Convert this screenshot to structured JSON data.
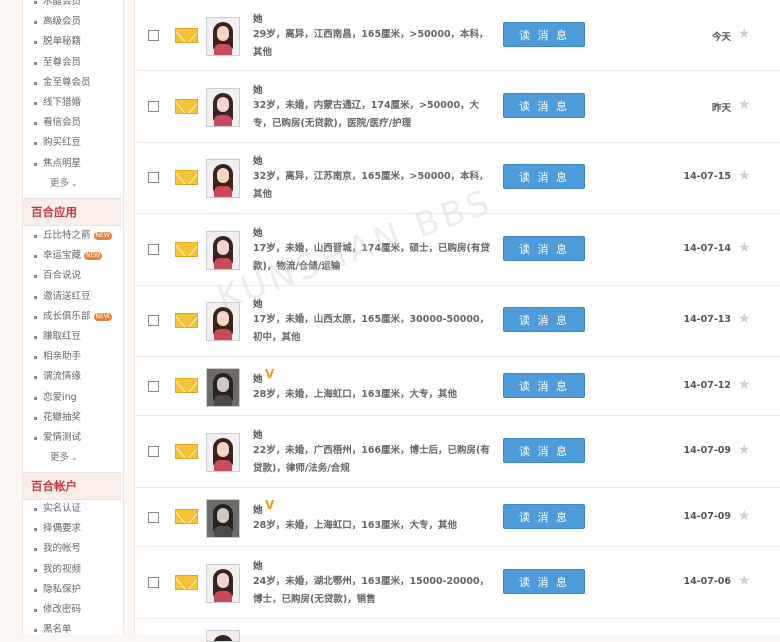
{
  "sidebar": {
    "group1": [
      {
        "label": "水晶会员"
      },
      {
        "label": "高级会员"
      },
      {
        "label": "脱单秘籍"
      },
      {
        "label": "至尊会员"
      },
      {
        "label": "金至尊会员"
      },
      {
        "label": "线下猎婚"
      },
      {
        "label": "看信会员"
      },
      {
        "label": "购买红豆"
      },
      {
        "label": "焦点明星"
      }
    ],
    "more_label": "更多",
    "apps_title": "百合应用",
    "apps": [
      {
        "label": "丘比特之箭",
        "new": "NEW"
      },
      {
        "label": "幸运宝藏",
        "new": "NEW"
      },
      {
        "label": "百合说说",
        "new": ""
      },
      {
        "label": "邀请送红豆",
        "new": ""
      },
      {
        "label": "成长俱乐部",
        "new": "NEW"
      },
      {
        "label": "赚取红豆",
        "new": ""
      },
      {
        "label": "相亲助手",
        "new": ""
      },
      {
        "label": "谓流情缘",
        "new": ""
      },
      {
        "label": "恋爱ing",
        "new": ""
      },
      {
        "label": "花瓣抽奖",
        "new": ""
      },
      {
        "label": "爱情测试",
        "new": ""
      }
    ],
    "account_title": "百合帐户",
    "account": [
      {
        "label": "实名认证"
      },
      {
        "label": "择偶要求"
      },
      {
        "label": "我的帐号"
      },
      {
        "label": "我的视频"
      },
      {
        "label": "隐私保护"
      },
      {
        "label": "修改密码"
      },
      {
        "label": "黑名单"
      }
    ]
  },
  "messages": [
    {
      "name": "她",
      "vip": false,
      "info": "29岁，离异，江西南昌，165厘米，>50000，本科，其他",
      "button": "读 消 息",
      "date": "今天",
      "avatar": "light"
    },
    {
      "name": "她",
      "vip": false,
      "info": "32岁，未婚，内蒙古通辽，174厘米，>50000，大专，已购房(无贷款)，医院/医疗/护理",
      "button": "读 消 息",
      "date": "昨天",
      "avatar": "light"
    },
    {
      "name": "她",
      "vip": false,
      "info": "32岁，离异，江苏南京，165厘米，>50000，本科，其他",
      "button": "读 消 息",
      "date": "14-07-15",
      "avatar": "light"
    },
    {
      "name": "她",
      "vip": false,
      "info": "17岁，未婚，山西晋城，174厘米，硕士，已购房(有贷款)，物流/仓储/运输",
      "button": "读 消 息",
      "date": "14-07-14",
      "avatar": "light"
    },
    {
      "name": "她",
      "vip": false,
      "info": "17岁，未婚，山西太原，165厘米，30000-50000，初中，其他",
      "button": "读 消 息",
      "date": "14-07-13",
      "avatar": "light"
    },
    {
      "name": "她",
      "vip": true,
      "info": "28岁，未婚，上海虹口，163厘米，大专，其他",
      "button": "读 消 息",
      "date": "14-07-12",
      "avatar": "dark"
    },
    {
      "name": "她",
      "vip": false,
      "info": "22岁，未婚，广西梧州，166厘米，博士后，已购房(有贷款)，律师/法务/合规",
      "button": "读 消 息",
      "date": "14-07-09",
      "avatar": "light"
    },
    {
      "name": "她",
      "vip": true,
      "info": "28岁，未婚，上海虹口，163厘米，大专，其他",
      "button": "读 消 息",
      "date": "14-07-09",
      "avatar": "dark"
    },
    {
      "name": "她",
      "vip": false,
      "info": "24岁，未婚，湖北鄂州，163厘米，15000-20000，博士，已购房(无贷款)，销售",
      "button": "读 消 息",
      "date": "14-07-06",
      "avatar": "light"
    }
  ],
  "watermark": "KUNSHAN BBS",
  "colors": {
    "accent_red": "#c03a47",
    "button_blue": "#4d9bd8",
    "envelope": "#f6c236"
  }
}
